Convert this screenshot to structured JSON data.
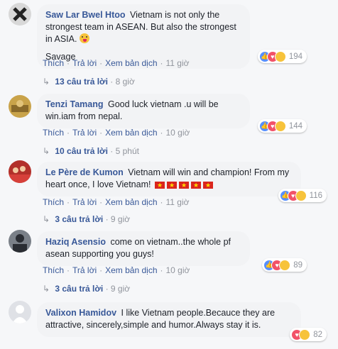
{
  "comments": [
    {
      "author": "Saw Lar Bwel Htoo",
      "text": "Vietnam is not only the strongest team in ASEAN. But also the strongest in ASIA.",
      "extra_line": "Savage",
      "actions": {
        "like": "Thích",
        "reply": "Trả lời",
        "translate": "Xem bản dịch",
        "time": "11 giờ"
      },
      "reaction_count": "194",
      "reactions": [
        "like",
        "love",
        "haha"
      ],
      "replies": {
        "count": "13 câu trả lời",
        "time": "8 giờ"
      }
    },
    {
      "author": "Tenzi Tamang",
      "text": "Good luck vietnam .u will be win.iam from nepal.",
      "actions": {
        "like": "Thích",
        "reply": "Trả lời",
        "translate": "Xem bản dịch",
        "time": "10 giờ"
      },
      "reaction_count": "144",
      "reactions": [
        "like",
        "love",
        "haha"
      ],
      "replies": {
        "count": "10 câu trả lời",
        "time": "5 phút"
      }
    },
    {
      "author": "Le Père de Kumon",
      "text": "Vietnam will win and champion! From my heart once, I love Vietnam!",
      "actions": {
        "like": "Thích",
        "reply": "Trả lời",
        "translate": "Xem bản dịch",
        "time": "11 giờ"
      },
      "reaction_count": "116",
      "reactions": [
        "like",
        "love",
        "haha"
      ],
      "replies": {
        "count": "3 câu trả lời",
        "time": "9 giờ"
      }
    },
    {
      "author": "Haziq Asensio",
      "text": "come on vietnam..the whole pf asean supporting you guys!",
      "actions": {
        "like": "Thích",
        "reply": "Trả lời",
        "translate": "Xem bản dịch",
        "time": "10 giờ"
      },
      "reaction_count": "89",
      "reactions": [
        "like",
        "love",
        "haha"
      ],
      "replies": {
        "count": "3 câu trả lời",
        "time": "9 giờ"
      }
    },
    {
      "author": "Valixon Hamidov",
      "text": "I like Vietnam people.Becauce they are attractive, sincerely,simple and humor.Always stay it is.",
      "reaction_count": "82",
      "reactions": [
        "love",
        "haha"
      ]
    }
  ],
  "colors": {
    "link": "#385898",
    "bubble": "#f2f3f5",
    "meta": "#90949c"
  }
}
